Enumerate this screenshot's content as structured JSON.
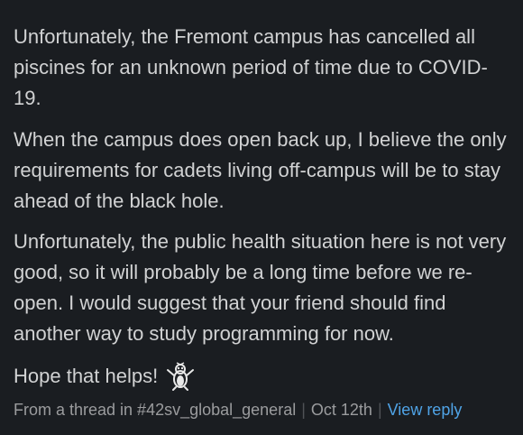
{
  "message": {
    "paragraphs": [
      "Unfortunately, the Fremont campus has cancelled all piscines for an unknown period of time due to COVID-19.",
      "When the campus does open back up, I believe the only requirements for cadets living off-campus will be to stay ahead of the black hole.",
      "Unfortunately, the public health situation here is not very good, so it will probably be a long time before we re-open. I would suggest that your friend should find another way to study programming for now."
    ],
    "closing": "Hope that helps!",
    "closing_emoji": "penguin-emoji"
  },
  "thread": {
    "prefix": "From a thread in #42sv_global_general",
    "date": "Oct 12th",
    "view_reply": "View reply"
  },
  "colors": {
    "background": "#1a1d21",
    "text": "#d1d2d3",
    "muted": "#9b9c9e",
    "link": "#4fa3e6"
  }
}
